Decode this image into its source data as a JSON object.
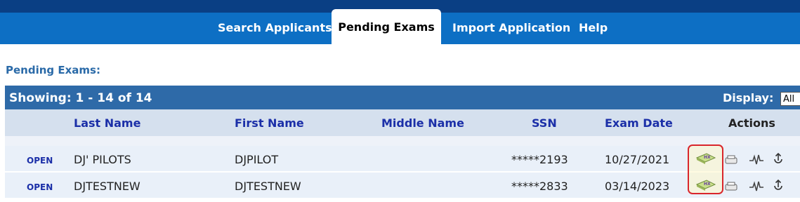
{
  "nav": {
    "tabs": [
      {
        "label": "Search Applicants",
        "active": false
      },
      {
        "label": "Pending Exams",
        "active": true
      },
      {
        "label": "Import Application",
        "active": false
      },
      {
        "label": "Help",
        "active": false
      }
    ]
  },
  "section_title": "Pending Exams:",
  "table": {
    "showing": "Showing: 1 - 14 of 14",
    "display_label": "Display:",
    "display_value": "All",
    "columns": [
      "Last Name",
      "First Name",
      "Middle Name",
      "SSN",
      "Exam Date",
      "Actions"
    ],
    "rows": [
      {
        "status": "OPEN",
        "last_name": "DJ' PILOTS",
        "first_name": "DJPILOT",
        "middle_name": "",
        "ssn": "*****2193",
        "exam_date": "10/27/2021"
      },
      {
        "status": "OPEN",
        "last_name": "DJTESTNEW",
        "first_name": "DJTESTNEW",
        "middle_name": "",
        "ssn": "*****2833",
        "exam_date": "03/14/2023"
      }
    ],
    "action_icons": [
      "hx-icon",
      "print-icon",
      "ekg-icon",
      "upload-icon"
    ]
  },
  "colors": {
    "top_strip": "#0a3f84",
    "nav_bar": "#0d6fc4",
    "showing_bar": "#2e6aa8",
    "header_row": "#d5e0ee",
    "link_blue": "#1b2fa8",
    "highlight_border": "#d9262b"
  }
}
